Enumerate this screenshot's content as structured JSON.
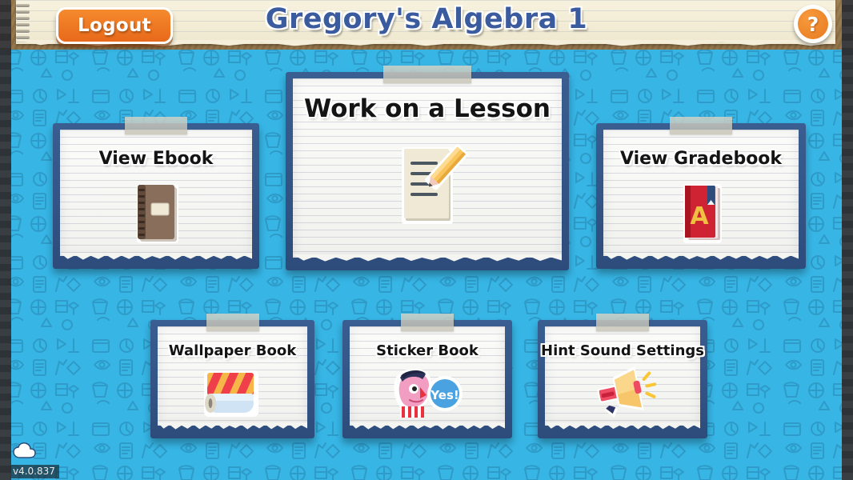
{
  "header": {
    "title": "Gregory's Algebra 1",
    "logout_label": "Logout",
    "help_label": "?",
    "help_icon": "question-mark-icon"
  },
  "colors": {
    "background_blue": "#37b6e6",
    "doodle_line": "#2f7fae",
    "card_frame_navy": "#2d4c7c",
    "title_blue": "#3a5b9e",
    "accent_orange": "#e87a20",
    "paper_cream": "#f7f2de",
    "cork_brown": "#8d7046"
  },
  "cards": [
    {
      "id": "lesson",
      "label": "Work on a Lesson",
      "icon": "notepad-and-pencil-icon"
    },
    {
      "id": "ebook",
      "label": "View Ebook",
      "icon": "spiral-notebook-icon"
    },
    {
      "id": "gradebook",
      "label": "View Gradebook",
      "icon": "red-book-grade-a-icon"
    },
    {
      "id": "wallpaper",
      "label": "Wallpaper Book",
      "icon": "wallpaper-roll-icon"
    },
    {
      "id": "sticker",
      "label": "Sticker Book",
      "icon": "character-sticker-yes-icon"
    },
    {
      "id": "hint",
      "label": "Hint Sound Settings",
      "icon": "megaphone-icon"
    }
  ],
  "gradebook_icon_letter": "A",
  "sticker_speech_text": "Yes!",
  "footer": {
    "version": "v4.0.837",
    "cloud_icon": "cloud-icon"
  }
}
